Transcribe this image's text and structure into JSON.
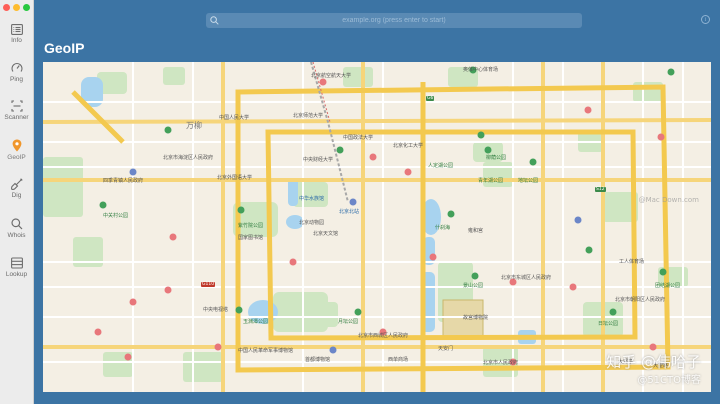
{
  "window": {
    "controls": [
      "close",
      "minimize",
      "zoom"
    ]
  },
  "sidebar": {
    "items": [
      {
        "label": "Info",
        "icon": "list-icon",
        "active": false
      },
      {
        "label": "Ping",
        "icon": "gauge-icon",
        "active": false
      },
      {
        "label": "Scanner",
        "icon": "scanner-icon",
        "active": false
      },
      {
        "label": "GeoIP",
        "icon": "location-pin-icon",
        "active": true
      },
      {
        "label": "Dig",
        "icon": "shovel-icon",
        "active": false
      },
      {
        "label": "Whois",
        "icon": "magnifier-icon",
        "active": false
      },
      {
        "label": "Lookup",
        "icon": "table-icon",
        "active": false
      }
    ]
  },
  "search": {
    "placeholder": "example.org (press enter to start)",
    "value": ""
  },
  "page": {
    "title": "GeoIP"
  },
  "map": {
    "labels": [
      {
        "text": "北京航空航天大学",
        "cls": ""
      },
      {
        "text": "奥体中心体育场",
        "cls": ""
      },
      {
        "text": "中国人民大学",
        "cls": ""
      },
      {
        "text": "北京师范大学",
        "cls": ""
      },
      {
        "text": "中国政法大学",
        "cls": ""
      },
      {
        "text": "北京化工大学",
        "cls": ""
      },
      {
        "text": "中央财经大学",
        "cls": ""
      },
      {
        "text": "万柳",
        "cls": "big"
      },
      {
        "text": "北京市海淀区人民政府",
        "cls": ""
      },
      {
        "text": "四季青镇人民政府",
        "cls": ""
      },
      {
        "text": "北京外国语大学",
        "cls": ""
      },
      {
        "text": "人定湖公园",
        "cls": "green"
      },
      {
        "text": "青年湖公园",
        "cls": "green"
      },
      {
        "text": "地坛公园",
        "cls": "green"
      },
      {
        "text": "柳荫公园",
        "cls": "green"
      },
      {
        "text": "北京动物园",
        "cls": ""
      },
      {
        "text": "北京北站",
        "cls": "blue"
      },
      {
        "text": "紫竹院公园",
        "cls": "green"
      },
      {
        "text": "中华水族馆",
        "cls": ""
      },
      {
        "text": "什刹海",
        "cls": "green"
      },
      {
        "text": "雍和宫",
        "cls": ""
      },
      {
        "text": "国家图书馆",
        "cls": ""
      },
      {
        "text": "北京天文馆",
        "cls": ""
      },
      {
        "text": "中关村公园",
        "cls": "green"
      },
      {
        "text": "景山公园",
        "cls": "green"
      },
      {
        "text": "北京市东城区人民政府",
        "cls": ""
      },
      {
        "text": "工人体育场",
        "cls": ""
      },
      {
        "text": "团结湖公园",
        "cls": "green"
      },
      {
        "text": "北京市朝阳区人民政府",
        "cls": ""
      },
      {
        "text": "中央电视塔",
        "cls": ""
      },
      {
        "text": "玉渊潭公园",
        "cls": "green"
      },
      {
        "text": "月坛公园",
        "cls": "green"
      },
      {
        "text": "故宫博物院",
        "cls": ""
      },
      {
        "text": "北京市西城区人民政府",
        "cls": ""
      },
      {
        "text": "日坛公园",
        "cls": "green"
      },
      {
        "text": "中国人民革命军事博物馆",
        "cls": ""
      },
      {
        "text": "首都博物馆",
        "cls": ""
      },
      {
        "text": "西单商场",
        "cls": ""
      },
      {
        "text": "天安门",
        "cls": ""
      },
      {
        "text": "北京市人民政府",
        "cls": ""
      },
      {
        "text": "大郊亭",
        "cls": ""
      },
      {
        "text": "大望路",
        "cls": ""
      },
      {
        "text": "G6",
        "cls": "road"
      },
      {
        "text": "S12",
        "cls": "road"
      },
      {
        "text": "G110",
        "cls": "roadr"
      }
    ],
    "watermarks": [
      "知乎 @伟哈子",
      "@51CTO博客",
      "@Mac Down.com"
    ]
  }
}
